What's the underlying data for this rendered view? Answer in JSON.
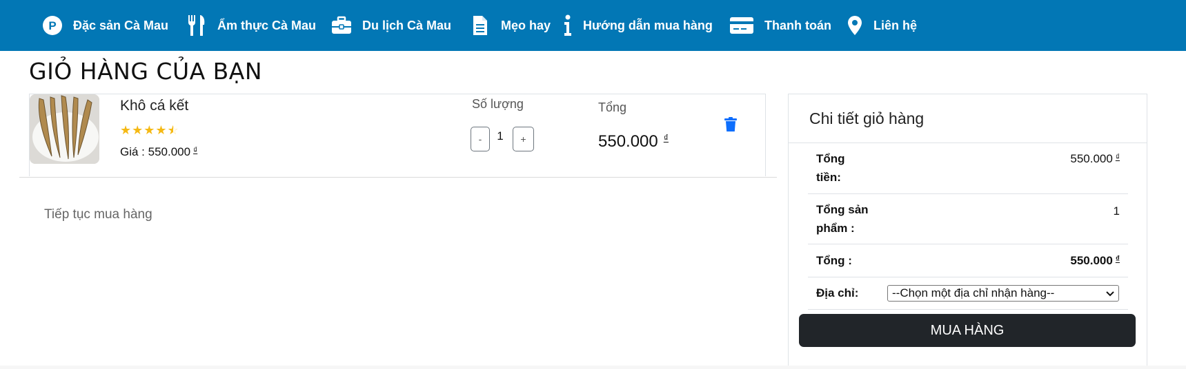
{
  "nav": {
    "items": [
      {
        "label": "Đặc sản Cà Mau",
        "icon": "p-circle-icon"
      },
      {
        "label": "Ẩm thực Cà Mau",
        "icon": "utensils-icon"
      },
      {
        "label": "Du lịch Cà Mau",
        "icon": "briefcase-icon"
      },
      {
        "label": "Mẹo hay",
        "icon": "document-icon"
      },
      {
        "label": "Hướng dẫn mua hàng",
        "icon": "info-icon"
      },
      {
        "label": "Thanh toán",
        "icon": "credit-card-icon"
      },
      {
        "label": "Liên hệ",
        "icon": "map-marker-icon"
      }
    ],
    "background": "#0277b5"
  },
  "page": {
    "title": "GIỎ HÀNG CỦA BẠN"
  },
  "cart": {
    "items": [
      {
        "name": "Khô cá kết",
        "rating": 4.5,
        "price_label": "Giá : 550.000",
        "currency": "₫",
        "quantity_label": "Số lượng",
        "quantity": "1",
        "decrement": "-",
        "increment": "+",
        "total_label": "Tổng",
        "total": "550.000",
        "image": "dried-fish-photo"
      }
    ],
    "continue_label": "Tiếp tục mua hàng"
  },
  "summary": {
    "title": "Chi tiết giỏ hàng",
    "subtotal_label_1": "Tổng",
    "subtotal_label_2": "tiền:",
    "subtotal_value": "550.000",
    "count_label_1": "Tổng sản",
    "count_label_2": "phẩm :",
    "count_value": "1",
    "total_label": "Tổng :",
    "total_value": "550.000",
    "currency": "₫",
    "address_label": "Địa chỉ:",
    "address_selected": "--Chọn một địa chỉ nhận hàng--",
    "buy_label": "MUA HÀNG"
  },
  "colors": {
    "accent": "#0277b5",
    "star": "#f5b914",
    "trash": "#0d6efd",
    "button_dark": "#212529"
  }
}
